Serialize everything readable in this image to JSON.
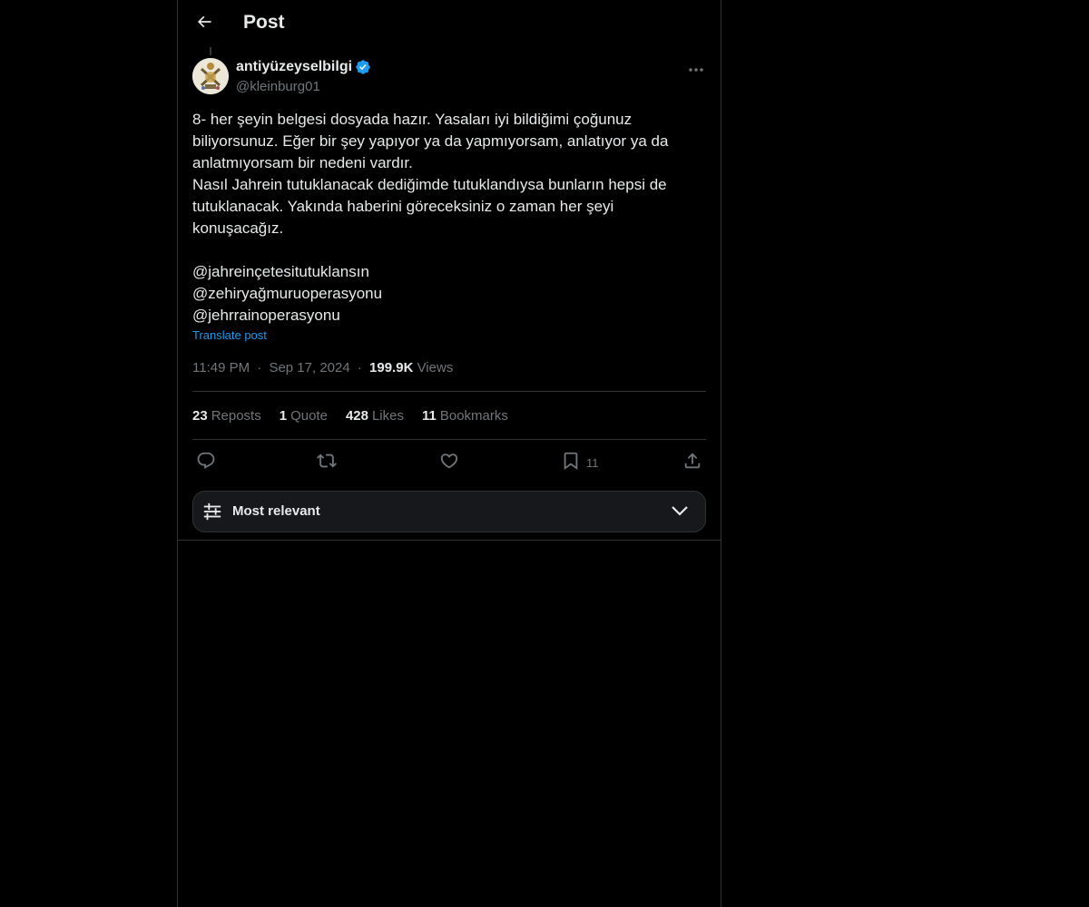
{
  "header": {
    "title": "Post"
  },
  "author": {
    "display_name": "antiyüzeyselbilgi",
    "handle": "@kleinburg01",
    "verified": true
  },
  "post": {
    "text": "8- her şeyin belgesi dosyada hazır. Yasaları iyi bildiğimi çoğunuz\nbiliyorsunuz. Eğer bir şey yapıyor ya da yapmıyorsam, anlatıyor ya da\nanlatmıyorsam bir nedeni vardır.\nNasıl Jahrein tutuklanacak dediğimde tutuklandıysa bunların hepsi de\ntutuklanacak. Yakında haberini göreceksiniz o zaman her şeyi\nkonuşacağız.",
    "mentions": [
      "@jahreinçetesitutuklansın",
      "@zehiryağmuruoperasyonu",
      "@jehrrainoperasyonu"
    ],
    "translate_label": "Translate post",
    "time": "11:49 PM",
    "date": "Sep 17, 2024",
    "separator": "·",
    "views_count": "199.9K",
    "views_label": "Views"
  },
  "stats": {
    "reposts_count": "23",
    "reposts_label": "Reposts",
    "quotes_count": "1",
    "quotes_label": "Quote",
    "likes_count": "428",
    "likes_label": "Likes",
    "bookmarks_count": "11",
    "bookmarks_label": "Bookmarks"
  },
  "actions": {
    "bookmark_count": "11",
    "icons": [
      "reply-icon",
      "repost-icon",
      "like-icon",
      "bookmark-icon",
      "share-icon"
    ]
  },
  "sort": {
    "label": "Most relevant"
  },
  "colors": {
    "background": "#000000",
    "text": "#e7e9ea",
    "muted": "#71767b",
    "accent": "#1d9bf0",
    "border": "#2f3336"
  }
}
